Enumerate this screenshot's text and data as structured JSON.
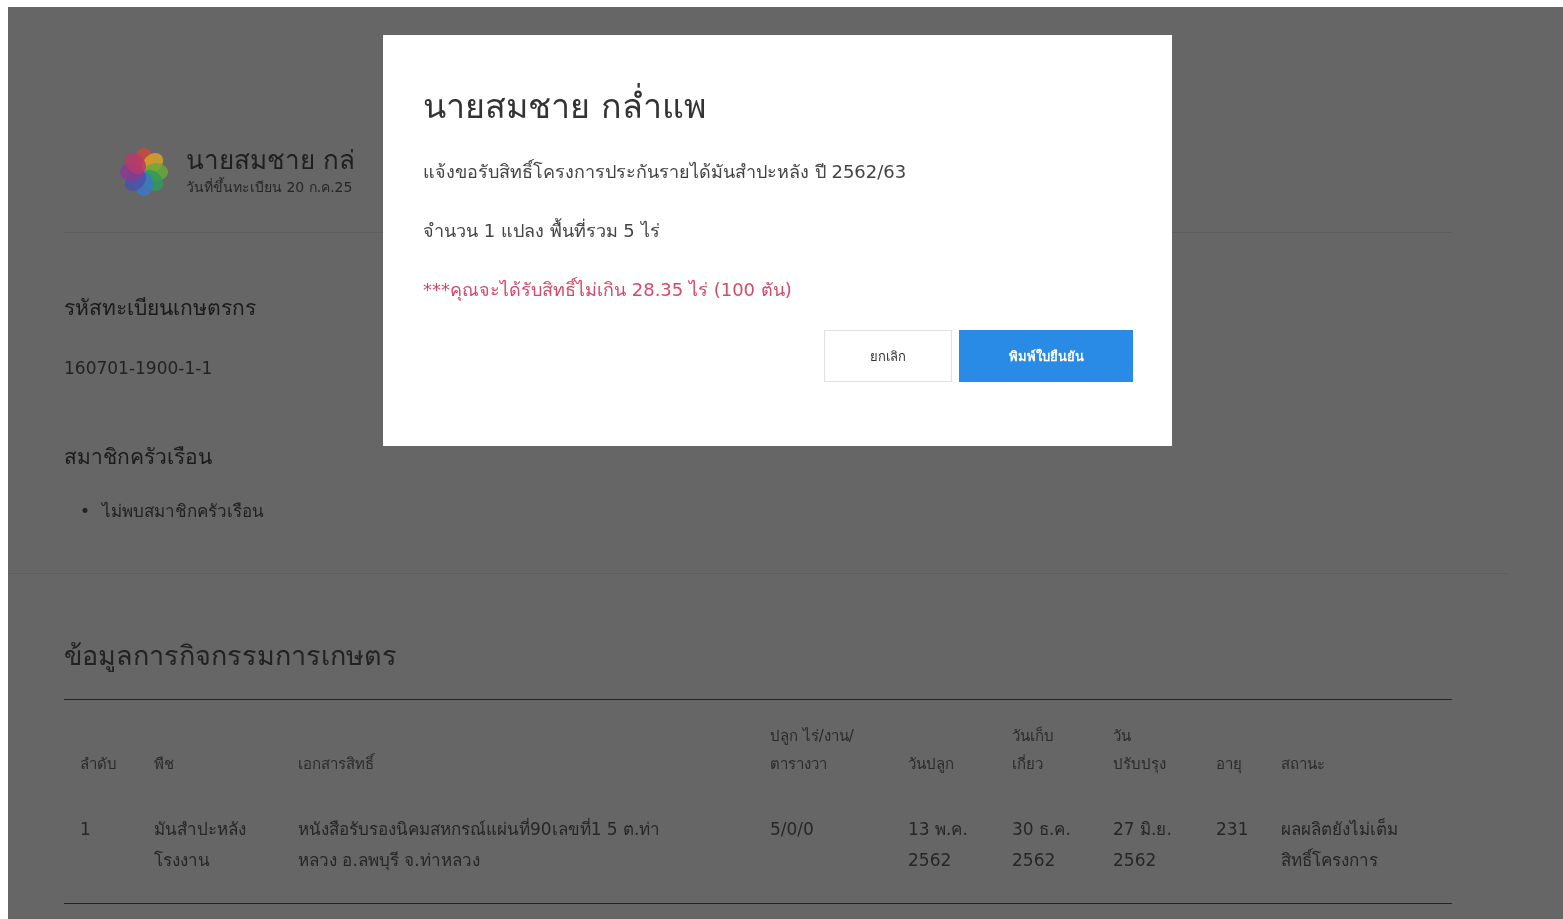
{
  "profile": {
    "name": "นายสมชาย กล่",
    "registered": "วันที่ขึ้นทะเบียน 20 ก.ค.25"
  },
  "farmer_id": {
    "heading": "รหัสทะเบียนเกษตรกร",
    "value": "160701-1900-1-1"
  },
  "household": {
    "heading": "สมาชิกครัวเรือน",
    "items": [
      {
        "bullet": "•",
        "text": "ไม่พบสมาชิกครัวเรือน"
      }
    ]
  },
  "activities": {
    "heading": "ข้อมูลการกิจกรรมการเกษตร",
    "columns": [
      "ลำดับ",
      "พืช",
      "เอกสารสิทธิ์",
      "ปลูก ไร่/งาน/\nตารางวา",
      "วันปลูก",
      "วันเก็บ\nเกี่ยว",
      "วัน\nปรับปรุง",
      "อายุ",
      "สถานะ"
    ],
    "rows": [
      [
        "1",
        "มันสำปะหลัง\nโรงงาน",
        "หนังสือรับรองนิคมสหกรณ์แผ่นที่90เลขที่1 5 ต.ท่า\nหลวง อ.ลพบุรี จ.ท่าหลวง",
        "5/0/0",
        "13 พ.ค.\n2562",
        "30 ธ.ค.\n2562",
        "27 มิ.ย.\n2562",
        "231",
        "ผลผลิตยังไม่เต็ม\nสิทธิ์โครงการ"
      ]
    ]
  },
  "dialog": {
    "title": "นายสมชาย กล่ำแพ",
    "lines": [
      {
        "text": "แจ้งขอรับสิทธิ์โครงการประกันรายได้มันสำปะหลัง ปี 2562/63",
        "kind": "normal"
      },
      {
        "text": "จำนวน 1 แปลง พื้นที่รวม 5 ไร่",
        "kind": "normal"
      },
      {
        "text": "***คุณจะได้รับสิทธิ์ไม่เกิน 28.35 ไร่ (100 ตัน)",
        "kind": "warning"
      }
    ],
    "buttons": [
      {
        "label": "ยกเลิก",
        "kind": "secondary"
      },
      {
        "label": "พิมพ์ใบยืนยัน",
        "kind": "primary"
      }
    ]
  }
}
